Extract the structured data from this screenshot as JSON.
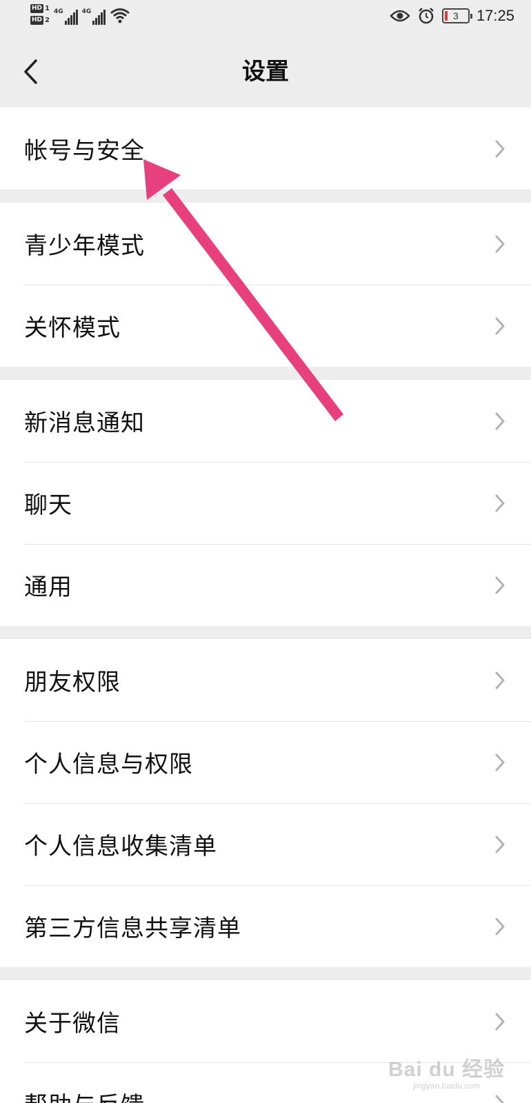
{
  "status_bar": {
    "sim1": {
      "hd": "HD",
      "num": "1",
      "network": "4G"
    },
    "sim2": {
      "hd": "HD",
      "num": "2",
      "network": "4G"
    },
    "battery_level": "3",
    "time": "17:25",
    "icons": [
      "signal-icon",
      "wifi-icon",
      "eye-icon",
      "alarm-icon",
      "battery-icon"
    ]
  },
  "header": {
    "title": "设置",
    "back_icon": "chevron-left-icon"
  },
  "groups": [
    {
      "items": [
        {
          "label": "帐号与安全"
        }
      ]
    },
    {
      "items": [
        {
          "label": "青少年模式"
        },
        {
          "label": "关怀模式"
        }
      ]
    },
    {
      "items": [
        {
          "label": "新消息通知"
        },
        {
          "label": "聊天"
        },
        {
          "label": "通用"
        }
      ]
    },
    {
      "items": [
        {
          "label": "朋友权限"
        },
        {
          "label": "个人信息与权限"
        },
        {
          "label": "个人信息收集清单"
        },
        {
          "label": "第三方信息共享清单"
        }
      ]
    },
    {
      "items": [
        {
          "label": "关于微信"
        },
        {
          "label": "帮助与反馈"
        }
      ]
    }
  ],
  "annotation": {
    "color": "#e8407c"
  },
  "watermark": {
    "main": "Bai du 经验",
    "sub": "jingyan.baidu.com"
  }
}
